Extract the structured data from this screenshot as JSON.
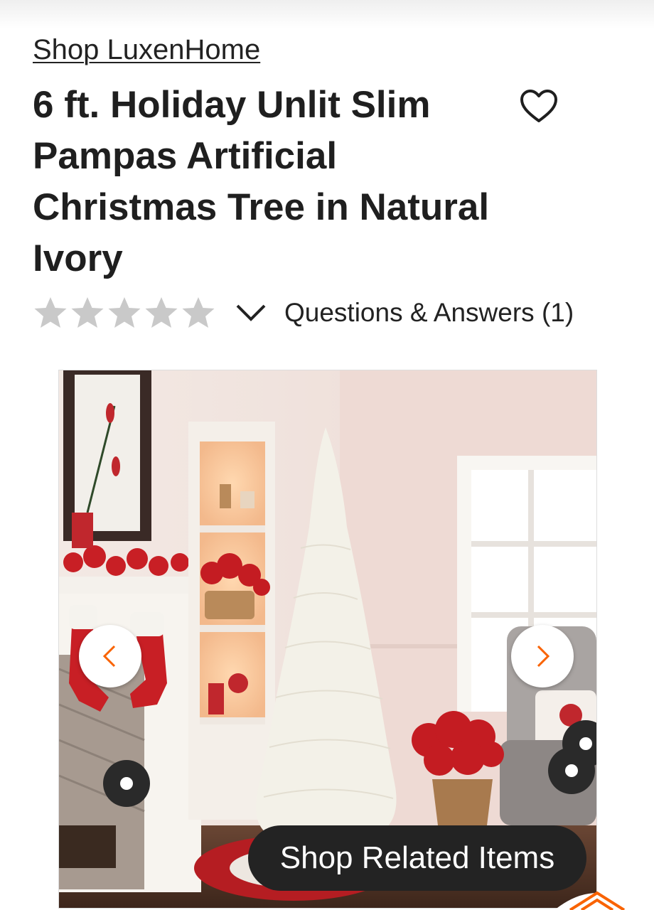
{
  "store": {
    "shop_link": "Shop LuxenHome"
  },
  "product": {
    "title": "6 ft. Holiday Unlit Slim Pampas Artificial Christmas Tree in Natural Ivory",
    "rating": 0,
    "max_rating": 5,
    "qa_label": "Questions & Answers (1)"
  },
  "gallery": {
    "related_label": "Shop Related Items"
  },
  "icons": {
    "favorite": "heart-icon",
    "rating": "star-icon",
    "expand": "chevron-down-icon",
    "prev": "chevron-left-icon",
    "next": "chevron-right-icon"
  },
  "colors": {
    "accent": "#f96302",
    "star_empty": "#c9c9c9",
    "button_dark": "#232323"
  }
}
